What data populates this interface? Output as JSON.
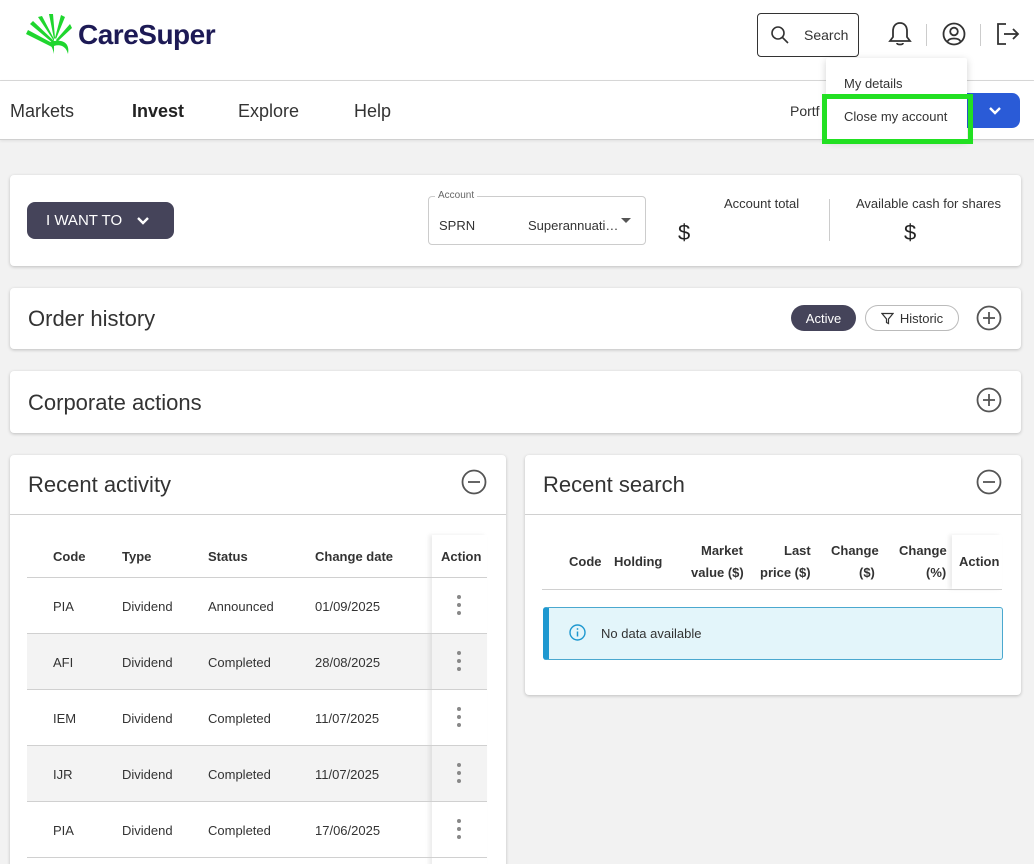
{
  "brand": {
    "name": "CareSuper",
    "color": "#1d1a55",
    "leaf_color": "#1fd62e"
  },
  "header": {
    "search_label": "Search",
    "icons": [
      "search-icon",
      "bell-icon",
      "user-circle-icon",
      "logout-icon"
    ]
  },
  "nav": {
    "items": [
      {
        "label": "Markets"
      },
      {
        "label": "Invest"
      },
      {
        "label": "Explore"
      },
      {
        "label": "Help"
      }
    ],
    "portfolio_partial": "Portf"
  },
  "user_menu": {
    "items": [
      {
        "label": "My details"
      },
      {
        "label": "Close my account"
      }
    ],
    "highlight_color": "#22e022"
  },
  "account_bar": {
    "i_want_to_label": "I WANT TO",
    "account_legend": "Account",
    "account_prefix": "SPRN",
    "account_type": "Superannuati…",
    "account_total_label": "Account total",
    "account_total_currency": "$",
    "available_cash_label": "Available cash for shares",
    "available_cash_currency": "$"
  },
  "order_history": {
    "title": "Order history",
    "filters": [
      {
        "label": "Active",
        "selected": true
      },
      {
        "label": "Historic",
        "selected": false
      }
    ]
  },
  "corporate_actions": {
    "title": "Corporate actions"
  },
  "recent_activity": {
    "title": "Recent activity",
    "columns": [
      "Code",
      "Type",
      "Status",
      "Change date",
      "Action"
    ],
    "rows": [
      {
        "code": "PIA",
        "type": "Dividend",
        "status": "Announced",
        "date": "01/09/2025"
      },
      {
        "code": "AFI",
        "type": "Dividend",
        "status": "Completed",
        "date": "28/08/2025"
      },
      {
        "code": "IEM",
        "type": "Dividend",
        "status": "Completed",
        "date": "11/07/2025"
      },
      {
        "code": "IJR",
        "type": "Dividend",
        "status": "Completed",
        "date": "11/07/2025"
      },
      {
        "code": "PIA",
        "type": "Dividend",
        "status": "Completed",
        "date": "17/06/2025"
      }
    ]
  },
  "recent_search": {
    "title": "Recent search",
    "columns": {
      "code": "Code",
      "holding": "Holding",
      "market_value_1": "Market",
      "market_value_2": "value ($)",
      "last_price_1": "Last",
      "last_price_2": "price ($)",
      "change_1": "Change",
      "change_2": "($)",
      "change_pct_1": "Change",
      "change_pct_2": "(%)",
      "action": "Action"
    },
    "empty_message": "No data available"
  },
  "colors": {
    "primary_dark": "#45445a",
    "accent_blue": "#2a5bd7",
    "info_bg": "#e3f5fa",
    "info_border": "#1e98d0"
  }
}
